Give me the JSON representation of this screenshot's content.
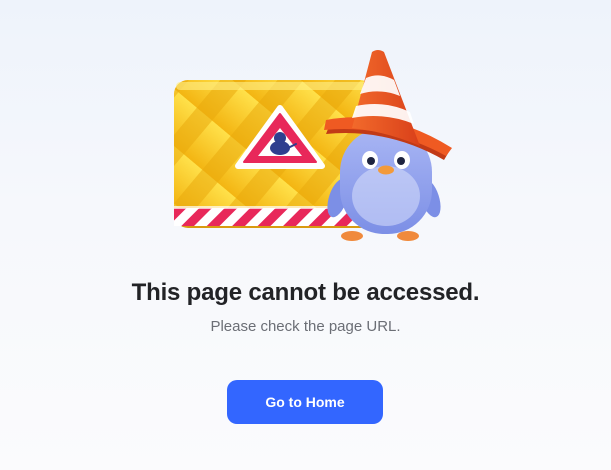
{
  "error": {
    "title": "This page cannot be accessed.",
    "message": "Please check the page URL.",
    "home_button_label": "Go to Home"
  },
  "colors": {
    "accent": "#3366ff",
    "sign_yellow": "#f7c318",
    "warning_red": "#e8285a",
    "cone_orange": "#f0501e",
    "penguin_blue": "#8fa2f0"
  },
  "icons": {
    "illustration": "construction-sign-penguin",
    "warning": "warning-triangle-icon",
    "cone": "traffic-cone-icon"
  }
}
